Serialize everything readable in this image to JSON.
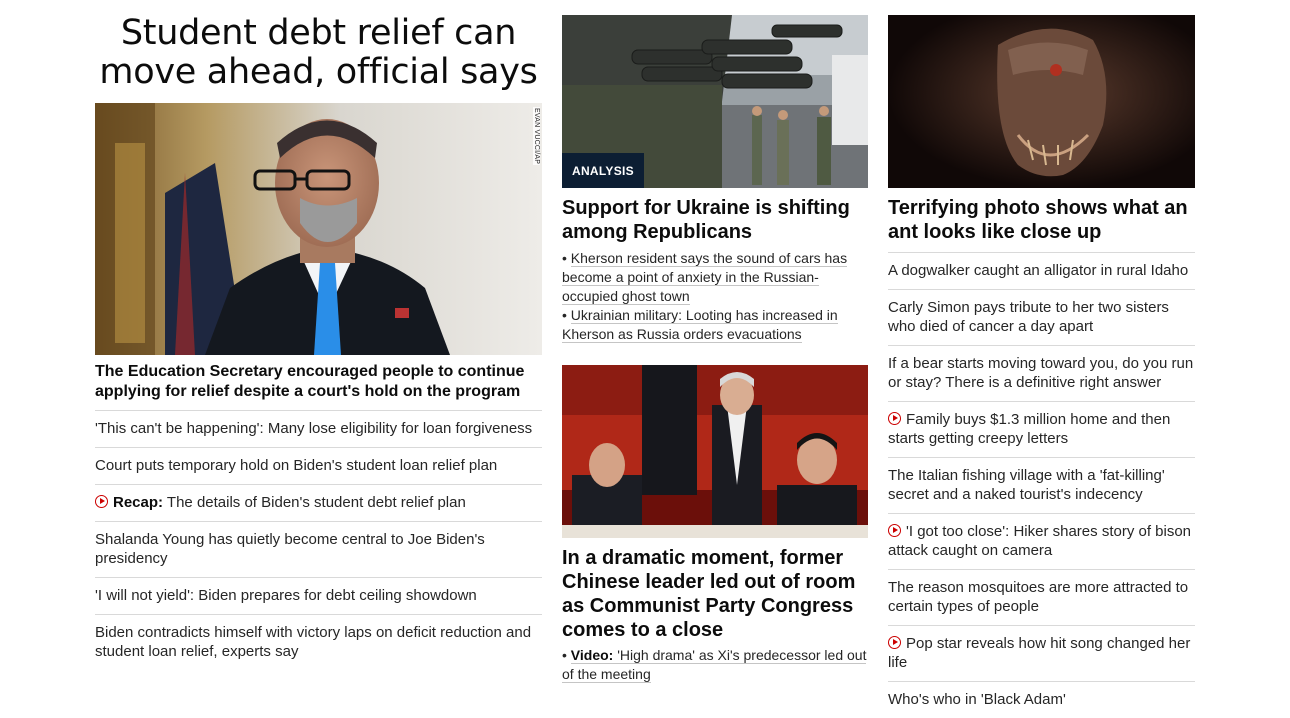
{
  "left": {
    "hero_title": "Student debt relief can move ahead, official says",
    "image_credit": "EVAN VUCCI/AP",
    "lead": "The Education Secretary encouraged people to continue applying for relief despite a court's hold on the program",
    "items": [
      {
        "text": "'This can't be happening': Many lose eligibility for loan forgiveness"
      },
      {
        "text": "Court puts temporary hold on Biden's student loan relief plan"
      },
      {
        "prefix": "Recap:",
        "text": " The details of Biden's student debt relief plan",
        "video": true
      },
      {
        "text": "Shalanda Young has quietly become central to Joe Biden's presidency"
      },
      {
        "text": "'I will not yield': Biden prepares for debt ceiling showdown"
      },
      {
        "text": "Biden contradicts himself with victory laps on deficit reduction and student loan relief, experts say"
      }
    ]
  },
  "middle": {
    "story1": {
      "badge": "ANALYSIS",
      "headline": "Support for Ukraine is shifting among Republicans",
      "bullets": [
        "Kherson resident says the sound of cars has become a point of anxiety in the Russian-occupied ghost town",
        "Ukrainian military: Looting has increased in Kherson as Russia orders evacuations"
      ]
    },
    "story2": {
      "headline": "In a dramatic moment, former Chinese leader led out of room as Communist Party Congress comes to a close",
      "bullet_prefix": "Video:",
      "bullet_text": " 'High drama' as Xi's predecessor led out of the meeting"
    }
  },
  "right": {
    "headline": "Terrifying photo shows what an ant looks like close up",
    "items": [
      {
        "text": "A dogwalker caught an alligator in rural Idaho",
        "video": false
      },
      {
        "text": "Carly Simon pays tribute to her two sisters who died of cancer a day apart",
        "video": false
      },
      {
        "text": "If a bear starts moving toward you, do you run or stay? There is a definitive right answer",
        "video": false
      },
      {
        "text": "Family buys $1.3 million home and then starts getting creepy letters",
        "video": true
      },
      {
        "text": "The Italian fishing village with a 'fat-killing' secret and a naked tourist's indecency",
        "video": false
      },
      {
        "text": "'I got too close': Hiker shares story of bison attack caught on camera",
        "video": true
      },
      {
        "text": "The reason mosquitoes are more attracted to certain types of people",
        "video": false
      },
      {
        "text": "Pop star reveals how hit song changed her life",
        "video": true
      },
      {
        "text": "Who's who in 'Black Adam'",
        "video": false
      }
    ]
  },
  "colors": {
    "play_icon": "#cc0000",
    "badge_bg": "#0c1e33",
    "divider": "#d9d9d9"
  }
}
